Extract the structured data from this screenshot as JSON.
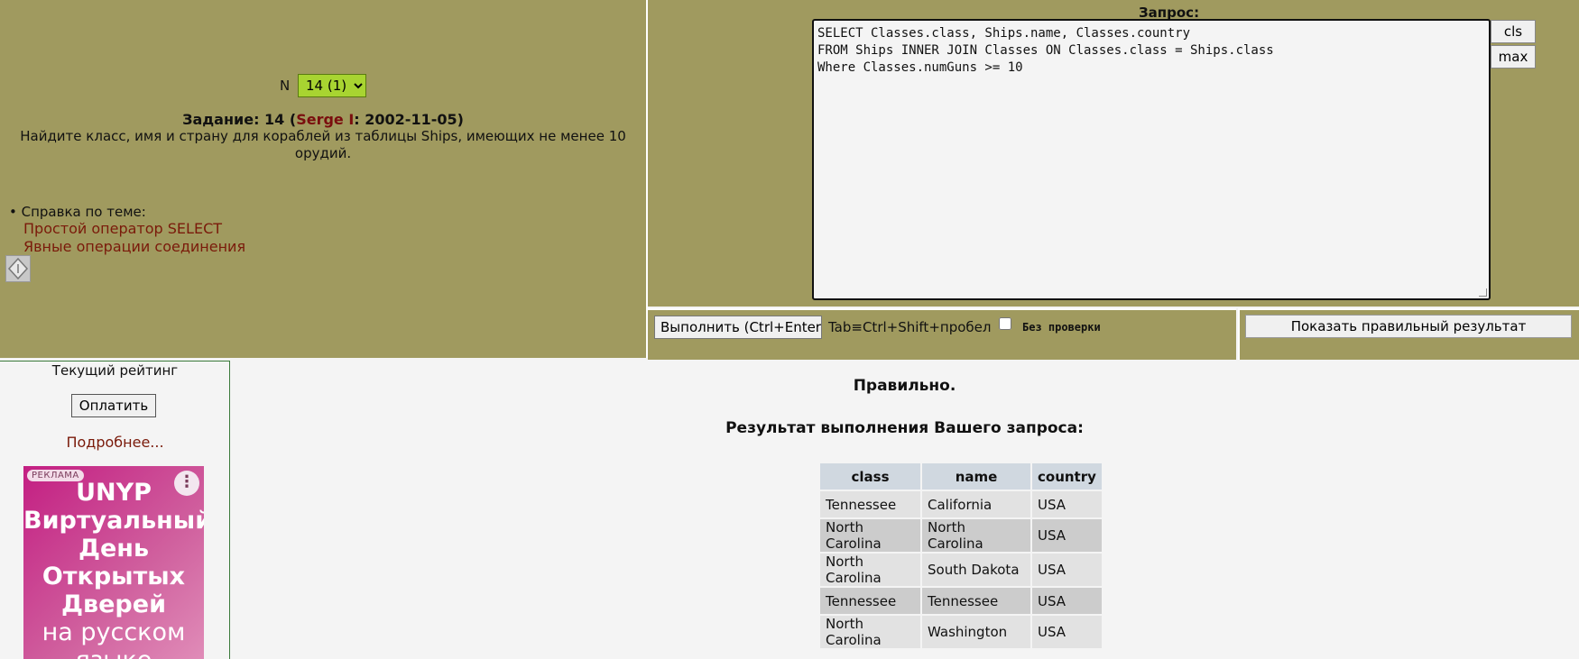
{
  "task": {
    "n_label": "N",
    "n_selected": "14 (1)",
    "title_prefix": "Задание: 14 (",
    "author": "Serge I",
    "title_suffix": ": 2002-11-05)",
    "description": "Найдите класс, имя и страну для кораблей из таблицы Ships, имеющих не менее 10 орудий."
  },
  "help": {
    "heading": "• Справка по теме:",
    "links": [
      "Простой оператор SELECT",
      "Явные операции соединения"
    ]
  },
  "query": {
    "label": "Запрос:",
    "sql": "SELECT Classes.class, Ships.name, Classes.country\nFROM Ships INNER JOIN Classes ON Classes.class = Ships.class\nWhere Classes.numGuns >= 10",
    "cls_label": "cls",
    "max_label": "max"
  },
  "controls": {
    "run_label": "Выполнить (Ctrl+Enter)",
    "tab_hint": "Tab≡Ctrl+Shift+пробел",
    "nocheck_label": "Без проверки",
    "show_result_label": "Показать правильный результат"
  },
  "rating": {
    "title": "Текущий рейтинг",
    "pay_label": "Оплатить",
    "more_label": "Подробнее..."
  },
  "ad": {
    "badge": "РЕКЛАМА",
    "menu_icon": "⋮",
    "line1": "UNYP",
    "line2": "Виртуальный",
    "line3": "День",
    "line4": "Открытых",
    "line5": "Дверей",
    "line6": "на русском",
    "line7": "языке"
  },
  "result": {
    "status": "Правильно.",
    "title": "Результат выполнения Вашего запроса:",
    "columns": [
      "class",
      "name",
      "country"
    ],
    "rows": [
      [
        "Tennessee",
        "California",
        "USA"
      ],
      [
        "North Carolina",
        "North Carolina",
        "USA"
      ],
      [
        "North Carolina",
        "South Dakota",
        "USA"
      ],
      [
        "Tennessee",
        "Tennessee",
        "USA"
      ],
      [
        "North Carolina",
        "Washington",
        "USA"
      ]
    ]
  },
  "colors": {
    "panel_olive": "#a09a5f",
    "select_green": "#a8d431",
    "link_red": "#7a1a0a",
    "ad_magenta": "#c31e82"
  }
}
